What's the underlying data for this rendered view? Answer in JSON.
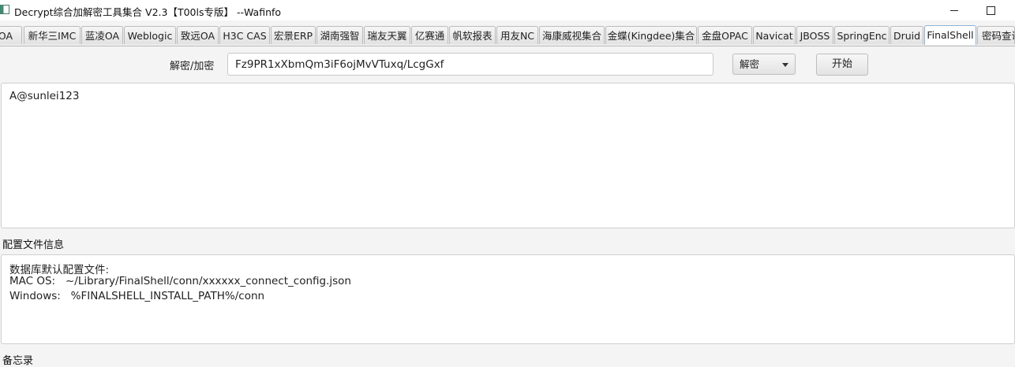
{
  "window": {
    "title": "Decrypt综合加解密工具集合 V2.3【T00ls专版】 --Wafinfo"
  },
  "tabs": [
    {
      "label": "OA"
    },
    {
      "label": "新华三IMC"
    },
    {
      "label": "蓝凌OA"
    },
    {
      "label": "Weblogic"
    },
    {
      "label": "致远OA"
    },
    {
      "label": "H3C CAS"
    },
    {
      "label": "宏景ERP"
    },
    {
      "label": "湖南强智"
    },
    {
      "label": "瑞友天翼"
    },
    {
      "label": "亿赛通"
    },
    {
      "label": "帆软报表"
    },
    {
      "label": "用友NC"
    },
    {
      "label": "海康威视集合"
    },
    {
      "label": "金蝶(Kingdee)集合"
    },
    {
      "label": "金盘OPAC"
    },
    {
      "label": "Navicat"
    },
    {
      "label": "JBOSS"
    },
    {
      "label": "SpringEnc"
    },
    {
      "label": "Druid"
    },
    {
      "label": "FinalShell",
      "active": true
    },
    {
      "label": "密码查询"
    }
  ],
  "controls": {
    "label": "解密/加密",
    "cipher_value": "Fz9PR1xXbmQm3iF6ojMvVTuxq/LcgGxf",
    "mode_selected": "解密",
    "start_label": "开始"
  },
  "output": {
    "text": "A@sunlei123"
  },
  "config_section": {
    "label": "配置文件信息",
    "lines": [
      "数据库默认配置文件:",
      "MAC OS:   ~/Library/FinalShell/conn/xxxxxx_connect_config.json",
      "Windows:   %FINALSHELL_INSTALL_PATH%/conn"
    ]
  },
  "notes_section": {
    "label": "备忘录"
  }
}
